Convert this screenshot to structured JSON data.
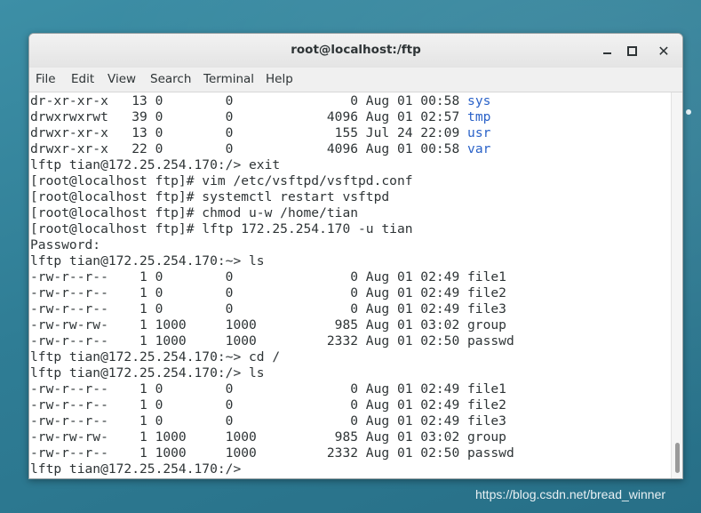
{
  "window": {
    "title": "root@localhost:/ftp",
    "controls": [
      "minimize",
      "maximize",
      "close"
    ]
  },
  "menubar": {
    "items": [
      "File",
      "Edit",
      "View",
      "Search",
      "Terminal",
      "Help"
    ]
  },
  "terminal": {
    "lines": [
      {
        "text": "dr-xr-xr-x   13 0        0               0 Aug 01 00:58 ",
        "name": "sys"
      },
      {
        "text": "drwxrwxrwt   39 0        0            4096 Aug 01 02:57 ",
        "name": "tmp"
      },
      {
        "text": "drwxr-xr-x   13 0        0             155 Jul 24 22:09 ",
        "name": "usr"
      },
      {
        "text": "drwxr-xr-x   22 0        0            4096 Aug 01 00:58 ",
        "name": "var"
      },
      {
        "text": "lftp tian@172.25.254.170:/> exit"
      },
      {
        "text": "[root@localhost ftp]# vim /etc/vsftpd/vsftpd.conf"
      },
      {
        "text": "[root@localhost ftp]# systemctl restart vsftpd"
      },
      {
        "text": "[root@localhost ftp]# chmod u-w /home/tian"
      },
      {
        "text": "[root@localhost ftp]# lftp 172.25.254.170 -u tian"
      },
      {
        "text": "Password:"
      },
      {
        "text": "lftp tian@172.25.254.170:~> ls"
      },
      {
        "text": "-rw-r--r--    1 0        0               0 Aug 01 02:49 file1"
      },
      {
        "text": "-rw-r--r--    1 0        0               0 Aug 01 02:49 file2"
      },
      {
        "text": "-rw-r--r--    1 0        0               0 Aug 01 02:49 file3"
      },
      {
        "text": "-rw-rw-rw-    1 1000     1000          985 Aug 01 03:02 group"
      },
      {
        "text": "-rw-r--r--    1 1000     1000         2332 Aug 01 02:50 passwd"
      },
      {
        "text": "lftp tian@172.25.254.170:~> cd /"
      },
      {
        "text": "lftp tian@172.25.254.170:/> ls"
      },
      {
        "text": "-rw-r--r--    1 0        0               0 Aug 01 02:49 file1"
      },
      {
        "text": "-rw-r--r--    1 0        0               0 Aug 01 02:49 file2"
      },
      {
        "text": "-rw-r--r--    1 0        0               0 Aug 01 02:49 file3"
      },
      {
        "text": "-rw-rw-rw-    1 1000     1000          985 Aug 01 03:02 group"
      },
      {
        "text": "-rw-r--r--    1 1000     1000         2332 Aug 01 02:50 passwd"
      },
      {
        "text": "lftp tian@172.25.254.170:/> "
      }
    ]
  },
  "colors": {
    "directory": "#2a62c8",
    "text": "#2e3436",
    "desktop": "#2f7d95"
  },
  "watermark": "https://blog.csdn.net/bread_winner"
}
